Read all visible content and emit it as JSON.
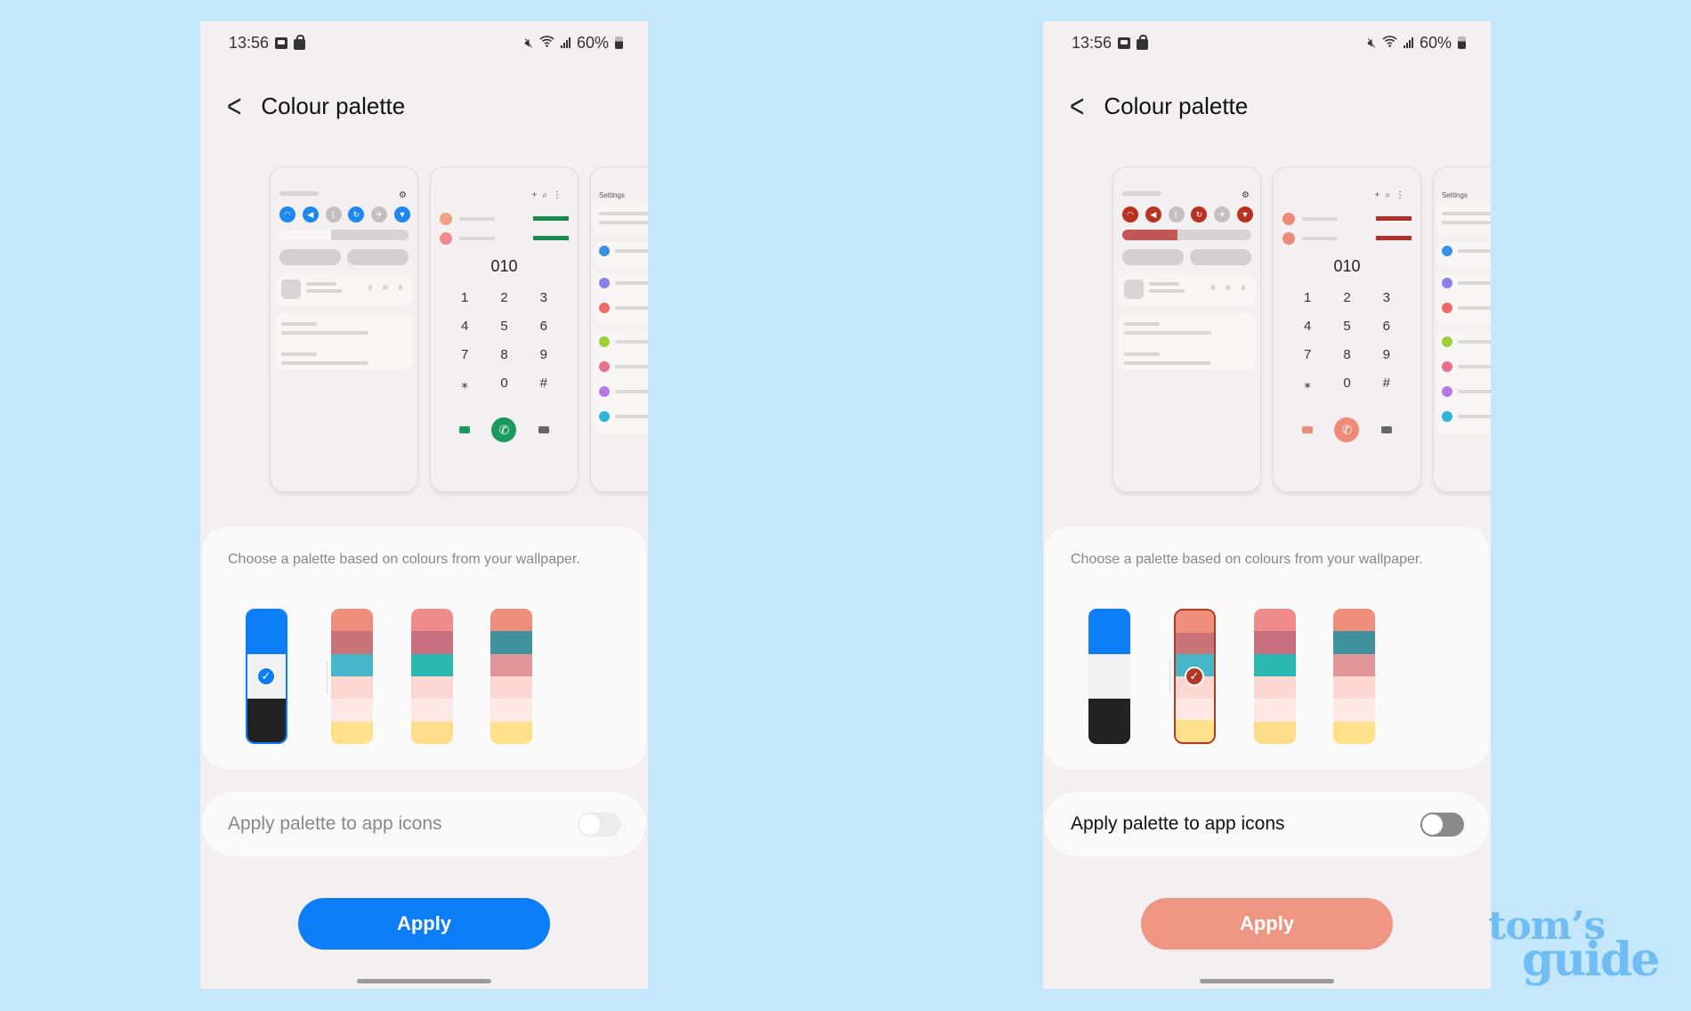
{
  "status_bar": {
    "time": "13:56",
    "battery": "60%",
    "icons_left": [
      "gallery-icon",
      "shopping-bag-icon"
    ],
    "icons_right": [
      "mute-icon",
      "wifi-icon",
      "signal-icon",
      "battery-icon"
    ]
  },
  "header": {
    "back_icon": "chevron-left-icon",
    "title": "Colour palette"
  },
  "preview": {
    "dialer_number": "010",
    "dialer_keys": [
      "1",
      "2",
      "3",
      "4",
      "5",
      "6",
      "7",
      "8",
      "9",
      "⁎",
      "0",
      "#"
    ],
    "settings_title": "Settings"
  },
  "palette_panel": {
    "description": "Choose a palette based on colours from your wallpaper."
  },
  "toggle": {
    "label": "Apply palette to app icons"
  },
  "apply_label": "Apply",
  "watermark": {
    "line1": "tom’s",
    "line2": "guide"
  },
  "palettes": [
    {
      "name": "basic",
      "bands": [
        "#0a7df7",
        "#f2f1f1",
        "#222222"
      ]
    },
    {
      "name": "wallpaper-1",
      "bands": [
        "#ee8e7b",
        "#c97478",
        "#47b6c8",
        "#fcd7d2",
        "#fde8e3",
        "#fde08a"
      ]
    },
    {
      "name": "wallpaper-2",
      "bands": [
        "#f08b8b",
        "#c97080",
        "#2cb9b2",
        "#fcd7d2",
        "#fde8e3",
        "#fddc8c"
      ]
    },
    {
      "name": "wallpaper-3",
      "bands": [
        "#ee8e7b",
        "#40929f",
        "#e2969a",
        "#fcd7d2",
        "#fde8e3",
        "#fde08a"
      ]
    }
  ],
  "screens": [
    {
      "id": "left",
      "selected_palette": 0,
      "accent": "#0a7df7",
      "toggle_on": false,
      "toggle_enabled": false,
      "toggle_label_color": "#888888",
      "apply_bg": "#0a7df7",
      "apply_text": "#ffffff",
      "quick_icons": [
        "#1e88f0",
        "#1e88f0",
        "#c4c0c1",
        "#1e88f0",
        "#c4c0c1",
        "#1e88f0"
      ],
      "brightness_fill": "#f8f6f6",
      "brightness_level": 0.4,
      "dialer_accent": "#1a9a5c",
      "dialer_bars": "#1a8a4f",
      "dialer_avatars": [
        "#f2a07f",
        "#ef8b8e"
      ]
    },
    {
      "id": "right",
      "selected_palette": 1,
      "accent": "#b23a24",
      "toggle_on": false,
      "toggle_enabled": true,
      "toggle_label_color": "#111111",
      "apply_bg": "#ee9583",
      "apply_text": "#ffffff",
      "quick_icons": [
        "#b8321f",
        "#b8321f",
        "#c4c0c1",
        "#b8321f",
        "#c4c0c1",
        "#b8321f"
      ],
      "brightness_fill": "#c2585a",
      "brightness_level": 0.43,
      "dialer_accent": "#ef8a78",
      "dialer_bars": "#b3302a",
      "dialer_avatars": [
        "#ef8a78",
        "#ef8a78"
      ]
    }
  ],
  "settings_icon_colors": [
    "#3a93e0",
    "#8b7fe8",
    "#f06a6a",
    "#9bd03a",
    "#e8708c",
    "#b47ae0",
    "#2fb3d6"
  ]
}
